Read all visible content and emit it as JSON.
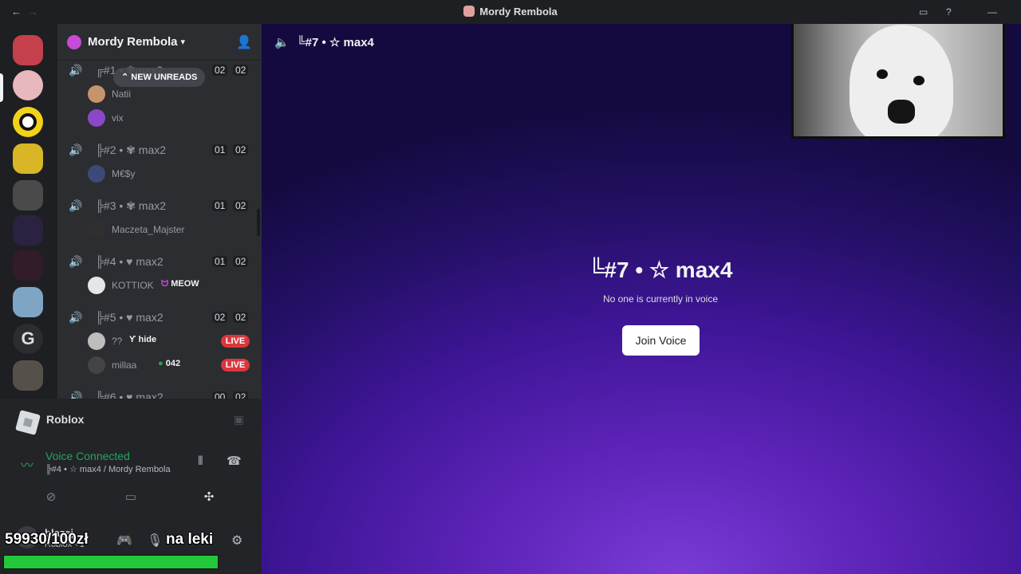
{
  "titlebar": {
    "title": "Mordy Rembola",
    "back": "←",
    "forward": "→"
  },
  "guild": {
    "name": "Mordy Rembola"
  },
  "new_unreads": "NEW UNREADS",
  "voice_channels": [
    {
      "name": "╔#1 • ✾max2",
      "c1": "02",
      "c2": "02",
      "members": [
        {
          "name": "Natii",
          "tag": ""
        },
        {
          "name": "vix",
          "tag": ""
        }
      ]
    },
    {
      "name": "╠#2 • ✾ max2",
      "c1": "01",
      "c2": "02",
      "members": [
        {
          "name": "M€$y",
          "tag": ""
        }
      ]
    },
    {
      "name": "╠#3 • ✾ max2",
      "c1": "01",
      "c2": "02",
      "members": [
        {
          "name": "Maczeta_Majster",
          "tag": ""
        }
      ]
    },
    {
      "name": "╠#4 • ♥ max2",
      "c1": "01",
      "c2": "02",
      "members": [
        {
          "name": "KOTTIOK",
          "tag": "MEOW"
        }
      ]
    },
    {
      "name": "╠#5 • ♥ max2",
      "c1": "02",
      "c2": "02",
      "members": [
        {
          "name": "??",
          "tag": "hide",
          "live": "LIVE"
        },
        {
          "name": "millaa",
          "tag": "042",
          "live": "LIVE"
        }
      ]
    },
    {
      "name": "╠#6 • ♥ max2",
      "c1": "00",
      "c2": "02",
      "members": []
    }
  ],
  "activity": {
    "name": "Roblox"
  },
  "voice": {
    "status": "Voice Connected",
    "channel": "╠#4 • ☆ max4 / Mordy Rembola"
  },
  "user": {
    "name": "blazej",
    "status": "Roblox +1"
  },
  "overlay": {
    "left_text": "59930/100zł",
    "right_text": "na leki",
    "progress_fraction": 1.0
  },
  "main": {
    "channel_name": "╚#7 • ☆ max4",
    "title": "╚#7 • ☆ max4",
    "subtitle": "No one is currently in voice",
    "join_label": "Join Voice"
  },
  "colors": {
    "green": "#23a559",
    "live_red": "#da373c",
    "blurple": "#5865f2"
  }
}
